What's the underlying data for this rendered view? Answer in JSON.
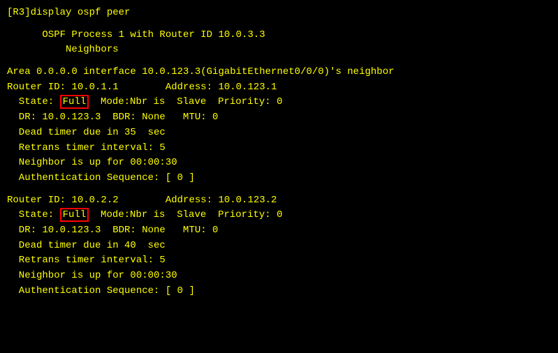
{
  "terminal": {
    "prompt": "[R3]display ospf peer",
    "header1": "      OSPF Process 1 with Router ID 10.0.3.3",
    "header2": "          Neighbors",
    "area_line": "Area 0.0.0.0 interface 10.0.123.3(GigabitEthernet0/0/0)'s neighbor",
    "router1": {
      "id_line": "Router ID: 10.0.1.1        Address: 10.0.123.1",
      "state_pre": "  State: ",
      "state_val": "Full",
      "state_post": "  Mode:Nbr is  Slave  Priority: 0",
      "dr_line": "  DR: 10.0.123.3  BDR: None   MTU: 0",
      "dead_line": "  Dead timer due in 35  sec",
      "retrans_line": "  Retrans timer interval: 5",
      "neighbor_line": "  Neighbor is up for 00:00:30",
      "auth_line": "  Authentication Sequence: [ 0 ]"
    },
    "router2": {
      "id_line": "Router ID: 10.0.2.2        Address: 10.0.123.2",
      "state_pre": "  State: ",
      "state_val": "Full",
      "state_post": "  Mode:Nbr is  Slave  Priority: 0",
      "dr_line": "  DR: 10.0.123.3  BDR: None   MTU: 0",
      "dead_line": "  Dead timer due in 40  sec",
      "retrans_line": "  Retrans timer interval: 5",
      "neighbor_line": "  Neighbor is up for 00:00:30",
      "auth_line": "  Authentication Sequence: [ 0 ]"
    }
  }
}
